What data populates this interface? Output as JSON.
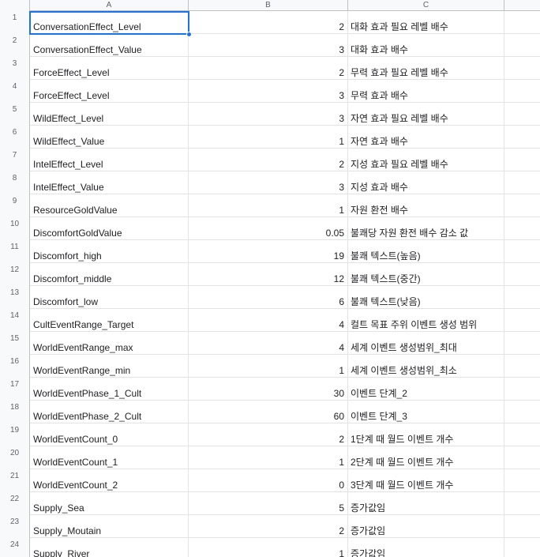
{
  "columns": [
    "A",
    "B",
    "C"
  ],
  "rows": [
    {
      "n": "1",
      "a": "ConversationEffect_Level",
      "b": "2",
      "c": "대화 효과 필요 레벨 배수"
    },
    {
      "n": "2",
      "a": "ConversationEffect_Value",
      "b": "3",
      "c": "대화 효과 배수"
    },
    {
      "n": "3",
      "a": "ForceEffect_Level",
      "b": "2",
      "c": "무력 효과 필요 레벨 배수"
    },
    {
      "n": "4",
      "a": "ForceEffect_Level",
      "b": "3",
      "c": "무력 효과 배수"
    },
    {
      "n": "5",
      "a": "WildEffect_Level",
      "b": "3",
      "c": "자연 효과 필요 레벨 배수"
    },
    {
      "n": "6",
      "a": "WildEffect_Value",
      "b": "1",
      "c": "자연 효과 배수"
    },
    {
      "n": "7",
      "a": "IntelEffect_Level",
      "b": "2",
      "c": "지성 효과 필요 레벨 배수"
    },
    {
      "n": "8",
      "a": "IntelEffect_Value",
      "b": "3",
      "c": "지성 효과 배수"
    },
    {
      "n": "9",
      "a": "ResourceGoldValue",
      "b": "1",
      "c": "자원 환전 배수"
    },
    {
      "n": "10",
      "a": "DiscomfortGoldValue",
      "b": "0.05",
      "c": "불쾌당 자원 환전 배수 감소 값"
    },
    {
      "n": "11",
      "a": "Discomfort_high",
      "b": "19",
      "c": "불쾌 텍스트(높음)"
    },
    {
      "n": "12",
      "a": "Discomfort_middle",
      "b": "12",
      "c": "불쾌 텍스트(중간)"
    },
    {
      "n": "13",
      "a": "Discomfort_low",
      "b": "6",
      "c": "불쾌 텍스트(낮음)"
    },
    {
      "n": "14",
      "a": "CultEventRange_Target",
      "b": "4",
      "c": "컬트 목표 주위 이벤트 생성 범위"
    },
    {
      "n": "15",
      "a": "WorldEventRange_max",
      "b": "4",
      "c": "세계 이벤트 생성범위_최대"
    },
    {
      "n": "16",
      "a": "WorldEventRange_min",
      "b": "1",
      "c": "세계 이벤트 생성범위_최소"
    },
    {
      "n": "17",
      "a": "WorldEventPhase_1_Cult",
      "b": "30",
      "c": "이벤트 단계_2"
    },
    {
      "n": "18",
      "a": "WorldEventPhase_2_Cult",
      "b": "60",
      "c": "이벤트 단계_3"
    },
    {
      "n": "19",
      "a": "WorldEventCount_0",
      "b": "2",
      "c": "1단계 때 월드 이벤트 개수"
    },
    {
      "n": "20",
      "a": "WorldEventCount_1",
      "b": "1",
      "c": "2단계 때 월드 이벤트 개수"
    },
    {
      "n": "21",
      "a": "WorldEventCount_2",
      "b": "0",
      "c": "3단계 때 월드 이벤트 개수"
    },
    {
      "n": "22",
      "a": "Supply_Sea",
      "b": "5",
      "c": "증가값임"
    },
    {
      "n": "23",
      "a": "Supply_Moutain",
      "b": "2",
      "c": "증가값임"
    },
    {
      "n": "24",
      "a": "Supply_River",
      "b": "1",
      "c": "증가값임"
    }
  ]
}
